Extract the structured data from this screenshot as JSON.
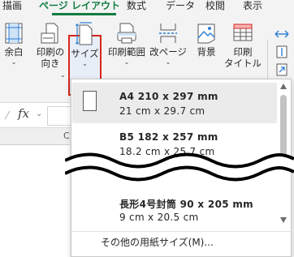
{
  "tabs": [
    {
      "label": "描画"
    },
    {
      "label": "ページ レイアウト"
    },
    {
      "label": "数式"
    },
    {
      "label": "データ"
    },
    {
      "label": "校閲"
    },
    {
      "label": "表示"
    }
  ],
  "active_tab": "ページ レイアウト",
  "ribbon": {
    "margins": {
      "label": "余白",
      "icon": "margins-icon"
    },
    "orientation": {
      "label1": "印刷の",
      "label2": "向き",
      "icon": "orientation-icon"
    },
    "size": {
      "label": "サイズ",
      "icon": "paper-size-icon"
    },
    "print_area": {
      "label": "印刷範囲",
      "icon": "print-area-icon"
    },
    "breaks": {
      "label": "改ページ",
      "icon": "page-break-icon"
    },
    "background": {
      "label": "背景",
      "icon": "background-image-icon"
    },
    "print_titles": {
      "label1": "印刷",
      "label2": "タイトル",
      "icon": "print-titles-icon"
    }
  },
  "formula_bar": {
    "fx": "fx"
  },
  "column_header": "C",
  "paper_sizes": [
    {
      "title": "A4 210 x 297 mm",
      "subtitle": "21 cm x 29.7 cm",
      "selected": true
    },
    {
      "title": "B5 182 x 257 mm",
      "subtitle": "18.2 cm x 25.7 cm",
      "selected": false
    },
    {
      "title": "長形4号封筒 90 x 205 mm",
      "subtitle": "9 cm x 20.5 cm",
      "selected": false
    }
  ],
  "more_sizes_label": "その他の用紙サイズ(M)...",
  "colors": {
    "accent_green": "#107c41",
    "highlight_red": "#d9261c",
    "selected_bg": "#ebebeb"
  }
}
